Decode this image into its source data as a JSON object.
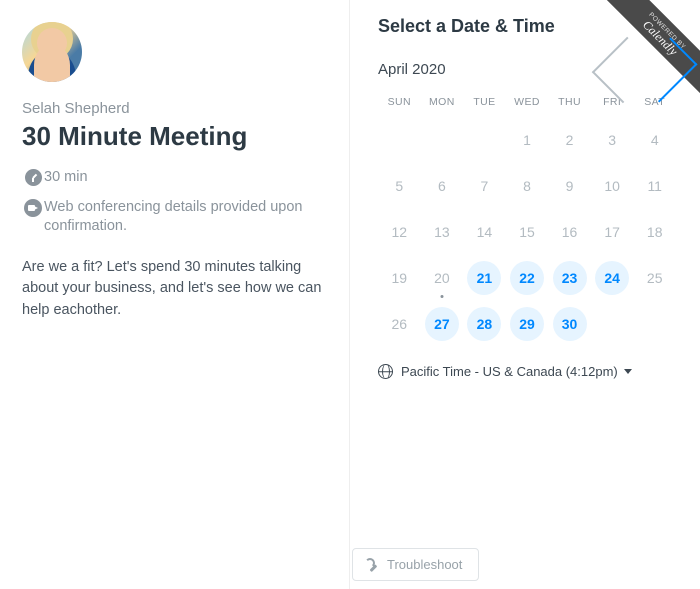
{
  "host": {
    "name": "Selah Shepherd"
  },
  "event": {
    "title": "30 Minute Meeting",
    "duration": "30 min",
    "location": "Web conferencing details provided upon confirmation.",
    "description": "Are we a fit? Let's spend 30 minutes talking about your business, and let's see how we can help eachother."
  },
  "ribbon": {
    "powered": "POWERED BY",
    "brand": "Calendly"
  },
  "right_title": "Select a Date & Time",
  "month": {
    "label": "April 2020"
  },
  "weekdays": [
    "SUN",
    "MON",
    "TUE",
    "WED",
    "THU",
    "FRI",
    "SAT"
  ],
  "days": [
    {
      "n": "",
      "a": false
    },
    {
      "n": "",
      "a": false
    },
    {
      "n": "",
      "a": false
    },
    {
      "n": "1",
      "a": false
    },
    {
      "n": "2",
      "a": false
    },
    {
      "n": "3",
      "a": false
    },
    {
      "n": "4",
      "a": false
    },
    {
      "n": "5",
      "a": false
    },
    {
      "n": "6",
      "a": false
    },
    {
      "n": "7",
      "a": false
    },
    {
      "n": "8",
      "a": false
    },
    {
      "n": "9",
      "a": false
    },
    {
      "n": "10",
      "a": false
    },
    {
      "n": "11",
      "a": false
    },
    {
      "n": "12",
      "a": false
    },
    {
      "n": "13",
      "a": false
    },
    {
      "n": "14",
      "a": false
    },
    {
      "n": "15",
      "a": false
    },
    {
      "n": "16",
      "a": false
    },
    {
      "n": "17",
      "a": false
    },
    {
      "n": "18",
      "a": false
    },
    {
      "n": "19",
      "a": false
    },
    {
      "n": "20",
      "a": false,
      "dot": true
    },
    {
      "n": "21",
      "a": true
    },
    {
      "n": "22",
      "a": true
    },
    {
      "n": "23",
      "a": true
    },
    {
      "n": "24",
      "a": true
    },
    {
      "n": "25",
      "a": false
    },
    {
      "n": "26",
      "a": false
    },
    {
      "n": "27",
      "a": true
    },
    {
      "n": "28",
      "a": true
    },
    {
      "n": "29",
      "a": true
    },
    {
      "n": "30",
      "a": true
    },
    {
      "n": "",
      "a": false
    },
    {
      "n": "",
      "a": false
    }
  ],
  "timezone": {
    "label": "Pacific Time - US & Canada (4:12pm)"
  },
  "troubleshoot": {
    "label": "Troubleshoot"
  }
}
